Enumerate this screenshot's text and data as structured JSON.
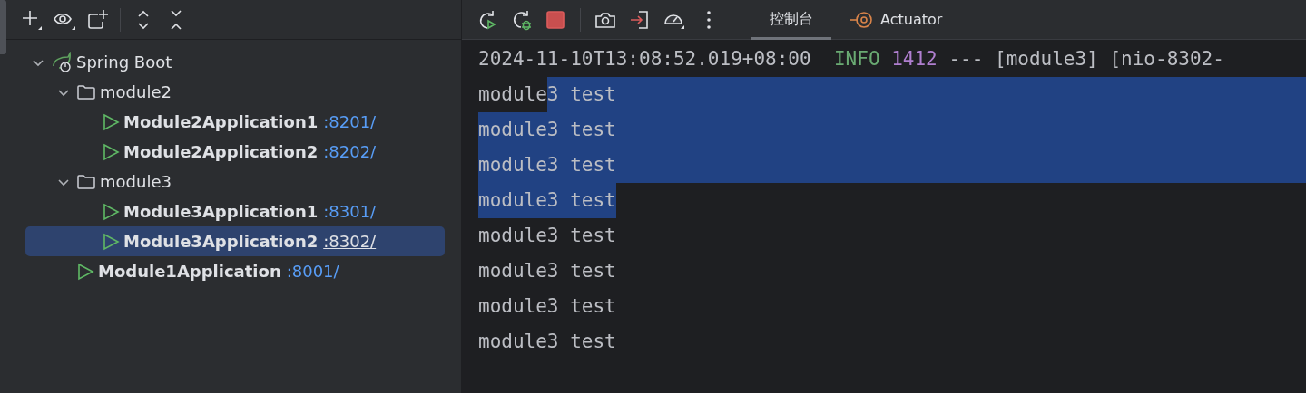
{
  "left_toolbar": {
    "buttons": [
      {
        "kind": "add"
      },
      {
        "kind": "view"
      },
      {
        "kind": "new-group"
      },
      {
        "kind": "separator"
      },
      {
        "kind": "expand"
      },
      {
        "kind": "collapse"
      }
    ]
  },
  "tree": [
    {
      "label": "Spring Boot",
      "kind": "root",
      "expanded": true,
      "selected": false,
      "children": [
        {
          "label": "module2",
          "kind": "folder",
          "expanded": true,
          "selected": false,
          "children": [
            {
              "label": "Module2Application1",
              "port": ":8201/",
              "kind": "app",
              "selected": false
            },
            {
              "label": "Module2Application2",
              "port": ":8202/",
              "kind": "app",
              "selected": false
            }
          ]
        },
        {
          "label": "module3",
          "kind": "folder",
          "expanded": true,
          "selected": false,
          "children": [
            {
              "label": "Module3Application1",
              "port": ":8301/",
              "kind": "app",
              "selected": false
            },
            {
              "label": "Module3Application2",
              "port": ":8302/",
              "kind": "app",
              "selected": true
            }
          ]
        },
        {
          "label": "Module1Application",
          "port": ":8001/",
          "kind": "app",
          "selected": false
        }
      ]
    }
  ],
  "console_toolbar": {
    "buttons": [
      {
        "kind": "rerun"
      },
      {
        "kind": "debug"
      },
      {
        "kind": "stop"
      },
      {
        "kind": "separator"
      },
      {
        "kind": "screenshot"
      },
      {
        "kind": "attach"
      },
      {
        "kind": "gauge"
      },
      {
        "kind": "more"
      }
    ],
    "tabs": [
      {
        "label": "控制台",
        "selected": true,
        "kind": "console"
      },
      {
        "label": "Actuator",
        "selected": false,
        "kind": "actuator"
      }
    ]
  },
  "console_lines": [
    {
      "segments": [
        {
          "text": "2024-11-10T13:08:52.019+08:00 ",
          "kind": "plain",
          "selected": false
        },
        {
          "text": "INFO",
          "kind": "level",
          "selected": false
        },
        {
          "text": "1412",
          "kind": "pid",
          "selected": false
        },
        {
          "text": "--- [module3] [nio-8302-",
          "kind": "plain",
          "selected": false
        }
      ],
      "selected_to_edge": false
    },
    {
      "segments": [
        {
          "text": "module",
          "kind": "plain",
          "selected": false
        },
        {
          "text": "3 test",
          "kind": "plain",
          "selected": true
        }
      ],
      "selected_to_edge": true
    },
    {
      "segments": [
        {
          "text": "module3 test",
          "kind": "plain",
          "selected": true
        }
      ],
      "selected_to_edge": true
    },
    {
      "segments": [
        {
          "text": "module3 test",
          "kind": "plain",
          "selected": true
        }
      ],
      "selected_to_edge": true
    },
    {
      "segments": [
        {
          "text": "module3 test",
          "kind": "plain",
          "selected": true
        }
      ],
      "selected_to_edge": false
    },
    {
      "segments": [
        {
          "text": "module3 test",
          "kind": "plain",
          "selected": false
        }
      ],
      "selected_to_edge": false
    },
    {
      "segments": [
        {
          "text": "module3 test",
          "kind": "plain",
          "selected": false
        }
      ],
      "selected_to_edge": false
    },
    {
      "segments": [
        {
          "text": "module3 test",
          "kind": "plain",
          "selected": false
        }
      ],
      "selected_to_edge": false
    },
    {
      "segments": [
        {
          "text": "module3 test",
          "kind": "plain",
          "selected": false
        }
      ],
      "selected_to_edge": false
    }
  ]
}
